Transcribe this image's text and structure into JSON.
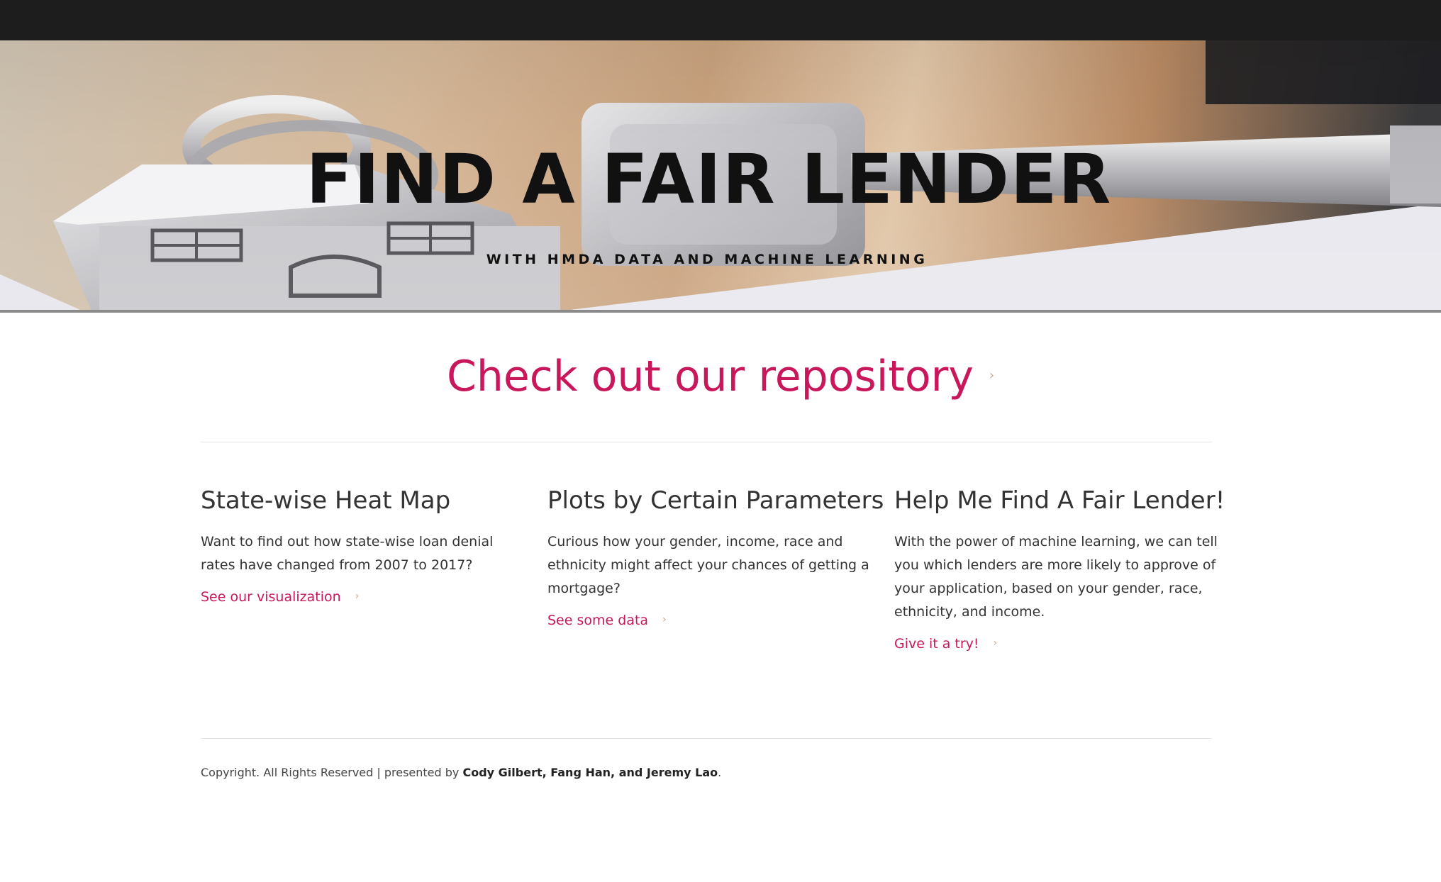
{
  "hero": {
    "title": "FIND A FAIR LENDER",
    "subtitle": "WITH HMDA DATA AND MACHINE LEARNING"
  },
  "repository": {
    "label": "Check out our repository",
    "chevron": "›"
  },
  "features": [
    {
      "title": "State-wise Heat Map",
      "description": "Want to find out how state-wise loan denial rates have changed from 2007 to 2017?",
      "link_label": "See our visualization"
    },
    {
      "title": "Plots by Certain Parameters",
      "description": "Curious how your gender, income, race and ethnicity might affect your chances of getting a mortgage?",
      "link_label": "See some data"
    },
    {
      "title": "Help Me Find A Fair Lender!",
      "description": "With the power of machine learning, we can tell you which lenders are more likely to approve of your application, based on your gender, race, ethnicity, and income.",
      "link_label": "Give it a try!"
    }
  ],
  "footer": {
    "copyright": "Copyright. All Rights Reserved | presented by",
    "authors": "Cody Gilbert, Fang Han, and Jeremy Lao",
    "end": "."
  },
  "colors": {
    "accent": "#c9175c",
    "topbar": "#1d1d1d",
    "text": "#333333",
    "chevron": "#c9a88f"
  },
  "icons": {
    "hero_image": "house-keychain-image",
    "link_arrow": "chevron-right-icon"
  }
}
